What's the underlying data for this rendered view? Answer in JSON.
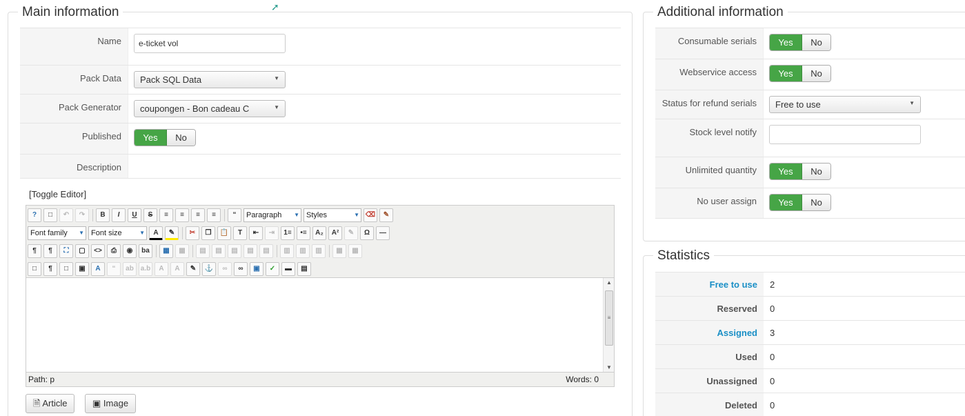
{
  "main": {
    "legend": "Main information",
    "name_label": "Name",
    "name_value": "e-ticket vol",
    "packdata_label": "Pack Data",
    "packdata_value": "Pack SQL Data",
    "packgen_label": "Pack Generator",
    "packgen_value": "coupongen - Bon cadeau C",
    "published_label": "Published",
    "yes": "Yes",
    "no": "No",
    "description_label": "Description",
    "toggle_editor": "[Toggle Editor]"
  },
  "editor": {
    "block_format": "Paragraph",
    "styles": "Styles",
    "font_family": "Font family",
    "font_size": "Font size",
    "path": "Path:  p",
    "words": "Words: 0",
    "article_btn": "Article",
    "image_btn": "Image",
    "glyphs": {
      "bold": "B",
      "italic": "I",
      "underline": "U",
      "strike": "S",
      "quote": "“",
      "sub": "A₂",
      "sup": "A²",
      "omega": "Ω"
    }
  },
  "additional": {
    "legend": "Additional information",
    "consumable_label": "Consumable serials",
    "webservice_label": "Webservice access",
    "refund_label": "Status for refund serials",
    "refund_value": "Free to use",
    "stock_label": "Stock level notify",
    "stock_value": "",
    "unlimited_label": "Unlimited quantity",
    "noassign_label": "No user assign",
    "yes": "Yes",
    "no": "No"
  },
  "statistics": {
    "legend": "Statistics",
    "rows": [
      {
        "label": "Free to use",
        "value": "2"
      },
      {
        "label": "Reserved",
        "value": "0"
      },
      {
        "label": "Assigned",
        "value": "3"
      },
      {
        "label": "Used",
        "value": "0"
      },
      {
        "label": "Unassigned",
        "value": "0"
      },
      {
        "label": "Deleted",
        "value": "0"
      }
    ]
  },
  "colors": {
    "yes_active": "#46a546",
    "link": "#1a8fc6"
  }
}
